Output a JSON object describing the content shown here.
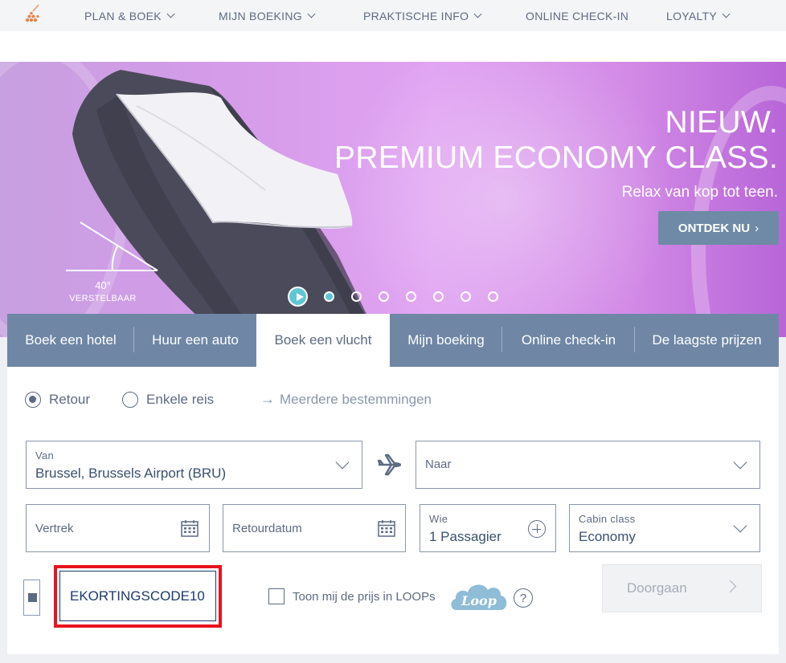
{
  "nav": {
    "logo_icon": "airline-logo-icon",
    "items": [
      {
        "label": "PLAN & BOEK",
        "has_dropdown": true
      },
      {
        "label": "MIJN BOEKING",
        "has_dropdown": true
      },
      {
        "label": "PRAKTISCHE INFO",
        "has_dropdown": true
      },
      {
        "label": "ONLINE CHECK-IN",
        "has_dropdown": false
      },
      {
        "label": "LOYALTY",
        "has_dropdown": true
      }
    ]
  },
  "hero": {
    "title_line1": "NIEUW.",
    "title_line2": "PREMIUM ECONOMY CLASS.",
    "subtitle": "Relax van kop tot teen.",
    "cta_label": "ONTDEK NU",
    "cta_arrow": "›",
    "angle_value": "40°",
    "angle_caption": "VERSTELBAAR",
    "carousel": {
      "slide_count": 8,
      "active_index": 0,
      "playing": false
    }
  },
  "booking": {
    "tabs": [
      {
        "label": "Boek een hotel",
        "active": false
      },
      {
        "label": "Huur een auto",
        "active": false
      },
      {
        "label": "Boek een vlucht",
        "active": true
      },
      {
        "label": "Mijn boeking",
        "active": false
      },
      {
        "label": "Online check-in",
        "active": false
      },
      {
        "label": "De laagste prijzen",
        "active": false
      }
    ],
    "trip_types": {
      "retour": "Retour",
      "one_way": "Enkele reis",
      "multi_city": "Meerdere bestemmingen",
      "selected": "retour"
    },
    "from": {
      "label": "Van",
      "value": "Brussel, Brussels Airport (BRU)"
    },
    "to": {
      "placeholder": "Naar"
    },
    "departure": {
      "placeholder": "Vertrek"
    },
    "return_date": {
      "placeholder": "Retourdatum"
    },
    "passengers": {
      "label": "Wie",
      "value": "1 Passagier"
    },
    "cabin": {
      "label": "Cabin class",
      "value": "Economy"
    },
    "promo": {
      "checked": true,
      "value": "EKORTINGSCODE10"
    },
    "loops": {
      "label": "Toon mij de prijs in LOOPs",
      "logo_text": "Loop",
      "help": "?"
    },
    "continue_label": "Doorgaan"
  },
  "colors": {
    "brand_navy": "#1b3a6b",
    "tab_bar": "#6f87a5",
    "accent_teal": "#5fc6d6",
    "highlight_red": "#e8131e",
    "hero_purple": "#d39be8"
  }
}
